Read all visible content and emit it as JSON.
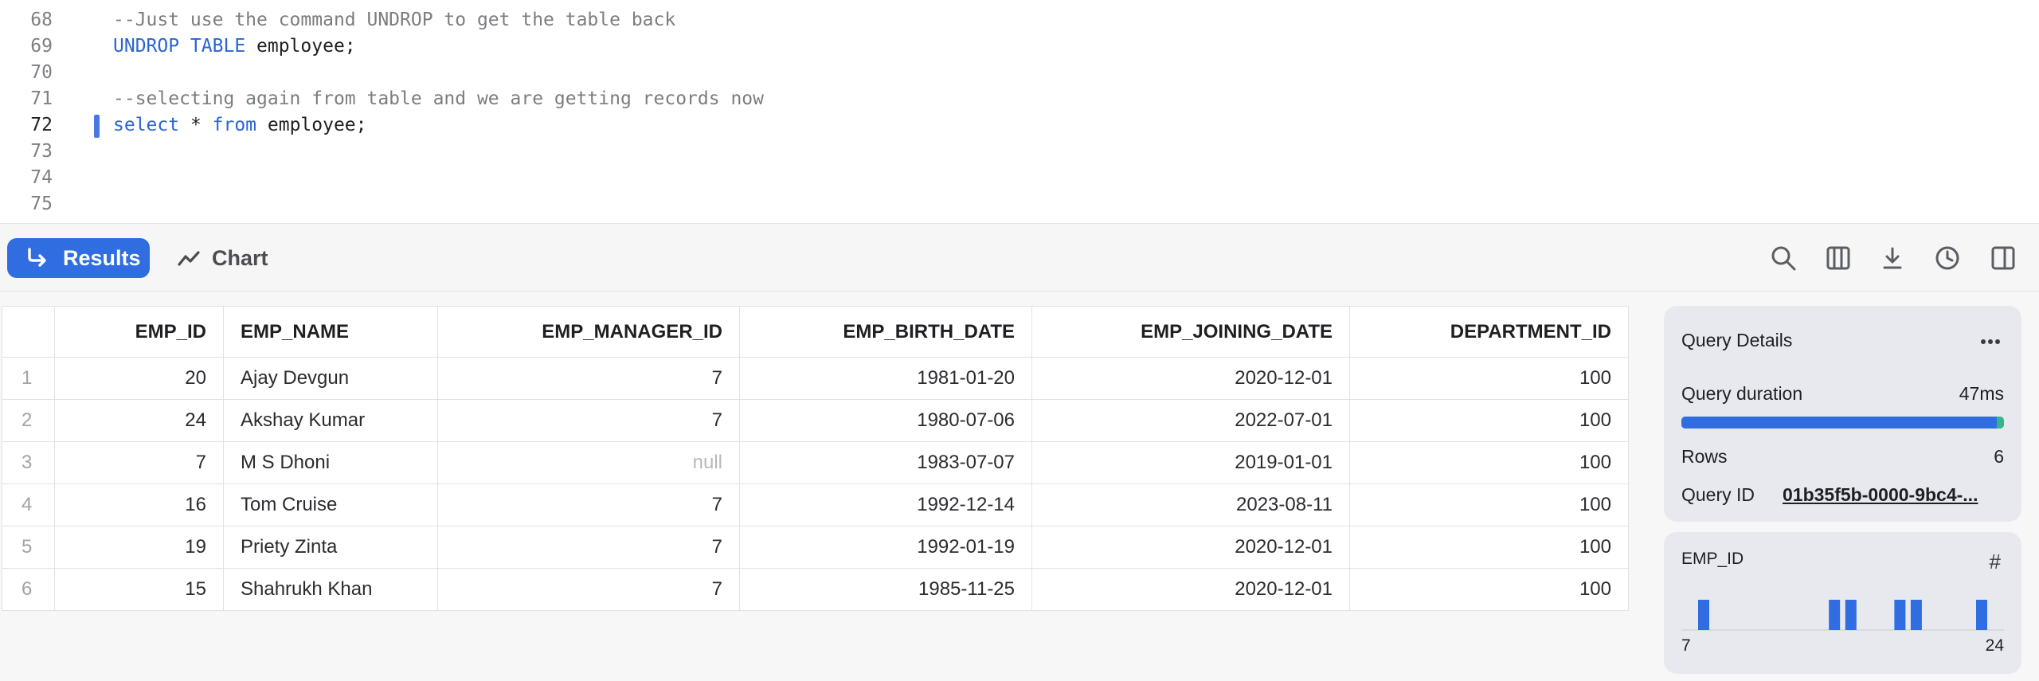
{
  "editor": {
    "lines": [
      {
        "num": "68",
        "text": "--Just use the command UNDROP to get the table back"
      },
      {
        "num": "69",
        "kw": "UNDROP TABLE",
        "rest": " employee;"
      },
      {
        "num": "70"
      },
      {
        "num": "71",
        "text": "--selecting again from table and we are getting records now"
      },
      {
        "num": "72",
        "kw1": "select",
        "mid": " * ",
        "kw2": "from",
        "rest": " employee;"
      },
      {
        "num": "73"
      },
      {
        "num": "74"
      },
      {
        "num": "75"
      }
    ]
  },
  "toolbar": {
    "results_label": "Results",
    "chart_label": "Chart",
    "icons": [
      "search-icon",
      "columns-icon",
      "download-icon",
      "history-icon",
      "split-view-icon"
    ]
  },
  "table": {
    "columns": [
      "EMP_ID",
      "EMP_NAME",
      "EMP_MANAGER_ID",
      "EMP_BIRTH_DATE",
      "EMP_JOINING_DATE",
      "DEPARTMENT_ID"
    ],
    "rows": [
      {
        "n": "1",
        "id": "20",
        "name": "Ajay Devgun",
        "mgr": "7",
        "birth": "1981-01-20",
        "join": "2020-12-01",
        "dept": "100"
      },
      {
        "n": "2",
        "id": "24",
        "name": "Akshay Kumar",
        "mgr": "7",
        "birth": "1980-07-06",
        "join": "2022-07-01",
        "dept": "100"
      },
      {
        "n": "3",
        "id": "7",
        "name": "M S Dhoni",
        "mgr": "null",
        "birth": "1983-07-07",
        "join": "2019-01-01",
        "dept": "100"
      },
      {
        "n": "4",
        "id": "16",
        "name": "Tom Cruise",
        "mgr": "7",
        "birth": "1992-12-14",
        "join": "2023-08-11",
        "dept": "100"
      },
      {
        "n": "5",
        "id": "19",
        "name": "Priety Zinta",
        "mgr": "7",
        "birth": "1992-01-19",
        "join": "2020-12-01",
        "dept": "100"
      },
      {
        "n": "6",
        "id": "15",
        "name": "Shahrukh Khan",
        "mgr": "7",
        "birth": "1985-11-25",
        "join": "2020-12-01",
        "dept": "100"
      }
    ]
  },
  "query_details": {
    "title": "Query Details",
    "duration_label": "Query duration",
    "duration_value": "47ms",
    "duration_progress": 0.98,
    "rows_label": "Rows",
    "rows_value": "6",
    "id_label": "Query ID",
    "id_value": "01b35f5b-0000-9bc4-..."
  },
  "column_stats": {
    "column": "EMP_ID",
    "min_label": "7",
    "max_label": "24",
    "values": [
      7,
      15,
      16,
      19,
      20,
      24
    ],
    "min": 7,
    "max": 24
  },
  "colors": {
    "accent": "#2f6de0",
    "progress_tail": "#33b68a"
  }
}
